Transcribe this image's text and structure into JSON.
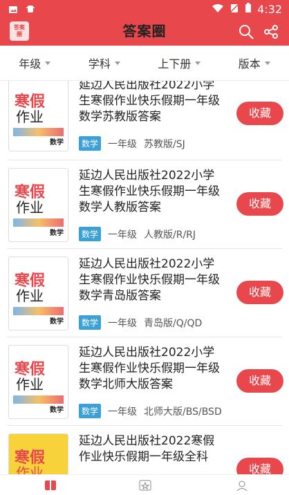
{
  "status": {
    "time": "4:32"
  },
  "app": {
    "title": "答案圈",
    "logo_text": "答案\n圈"
  },
  "filters": [
    "年级",
    "学科",
    "上下册",
    "版本"
  ],
  "items": [
    {
      "title": "延边人民出版社2022小学生寒假作业快乐假期一年级数学苏教版答案",
      "tag": "数学",
      "grade": "一年级",
      "edition": "苏教版/SJ",
      "fav": "收藏"
    },
    {
      "title": "延边人民出版社2022小学生寒假作业快乐假期一年级数学人教版答案",
      "tag": "数学",
      "grade": "一年级",
      "edition": "人教版/R/RJ",
      "fav": "收藏"
    },
    {
      "title": "延边人民出版社2022小学生寒假作业快乐假期一年级数学青岛版答案",
      "tag": "数学",
      "grade": "一年级",
      "edition": "青岛版/Q/QD",
      "fav": "收藏"
    },
    {
      "title": "延边人民出版社2022小学生寒假作业快乐假期一年级数学北师大版答案",
      "tag": "数学",
      "grade": "一年级",
      "edition": "北师大版/BS/BSD",
      "fav": "收藏"
    },
    {
      "title": "延边人民出版社2022寒假作业快乐假期一年级全科",
      "fav": "收藏"
    }
  ],
  "colors": {
    "accent": "#e8474c",
    "tag": "#3aa0d6"
  }
}
